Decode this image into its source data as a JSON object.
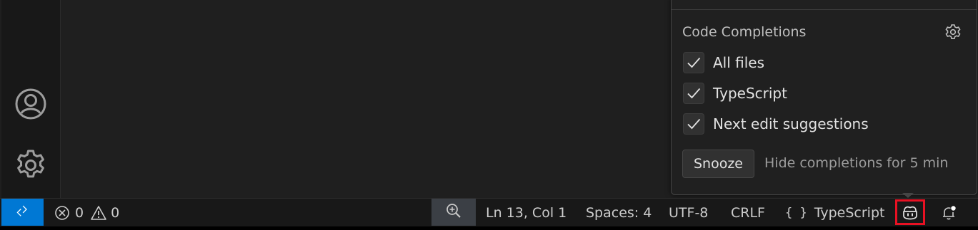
{
  "activity_bar": {
    "icons": [
      "account-icon",
      "manage-gear-icon"
    ]
  },
  "popup": {
    "title": "Code Completions",
    "settings_icon": "gear-icon",
    "options": [
      {
        "label": "All files",
        "checked": true
      },
      {
        "label": "TypeScript",
        "checked": true
      },
      {
        "label": "Next edit suggestions",
        "checked": true
      }
    ],
    "snooze_label": "Snooze",
    "snooze_hint": "Hide completions for 5 min"
  },
  "status_bar": {
    "remote_icon": "remote-icon",
    "errors_count": "0",
    "warnings_count": "0",
    "zoom_icon": "zoom-in-icon",
    "cursor_position": "Ln 13, Col 1",
    "indentation": "Spaces: 4",
    "encoding": "UTF-8",
    "line_ending": "CRLF",
    "language_braces": "{ }",
    "language": "TypeScript",
    "copilot_icon": "copilot-icon",
    "notifications_icon": "bell-dot-icon"
  },
  "colors": {
    "accent": "#0078d4",
    "highlight_outline": "#e81123",
    "background": "#1f1f1f",
    "statusbar": "#181818"
  }
}
